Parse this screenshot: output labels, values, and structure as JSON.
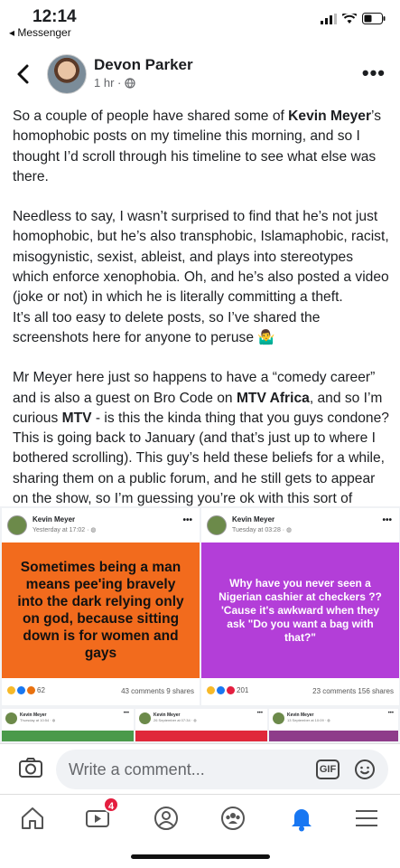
{
  "status_bar": {
    "time": "12:14",
    "back_app": "◂ Messenger"
  },
  "post": {
    "author": "Devon Parker",
    "timestamp": "1 hr ·",
    "paragraphs": [
      {
        "segments": [
          "So a couple of people have shared some of ",
          "Kevin Meyer",
          "’s homophobic posts on my timeline this morning, and so I thought I’d scroll through his timeline to see what else was there."
        ]
      },
      {
        "text": "Needless to say, I wasn’t surprised to find that he’s not just homophobic, but he’s also transphobic, Islamaphobic, racist, misogynistic, sexist, ableist, and plays into stereotypes which enforce xenophobia. Oh, and he’s also posted a video (joke or not) in which he is literally committing a theft."
      },
      {
        "text": "It’s all too easy to delete posts, so I’ve shared the screenshots here for anyone to peruse 🤷‍♂️"
      },
      {
        "segments": [
          "Mr Meyer here just so happens to have a “comedy career” and is also a guest on Bro Code on ",
          "MTV Africa",
          ", and so I’m curious ",
          "MTV",
          " - is this the kinda thing that you guys condone? This is going back to January (and that’s just up to where I bothered scrolling). This guy’s held these beliefs for a while, sharing them on a public forum, and he still gets to appear on the show, so I’m guessing you’re ok with this sort of thing?"
        ]
      }
    ]
  },
  "shared_posts": [
    {
      "name": "Kevin Meyer",
      "time": "Yesterday at 17:02 · ◍",
      "meme_text": "Sometimes being a man means pee'ing bravely into the dark relying only on god, because sitting down is for women and gays",
      "reaction_count": "62",
      "stats": "43 comments  9 shares",
      "bg_color": "#f26b1d"
    },
    {
      "name": "Kevin Meyer",
      "time": "Tuesday at 03:28 · ◍",
      "meme_text": "Why have you never seen a Nigerian cashier at checkers ?? 'Cause it's awkward when they ask \"Do you want a bag with that?\"",
      "reaction_count": "201",
      "stats": "23 comments  156 shares",
      "bg_color": "#b33ed8"
    }
  ],
  "mini_posts": [
    {
      "name": "Kevin Meyer",
      "time": "Thursday at 10:54 · ◍",
      "bar_color": "#4a9a4a"
    },
    {
      "name": "Kevin Meyer",
      "time": "26 September at 07:34 · ◍",
      "bar_color": "#e0283a"
    },
    {
      "name": "Kevin Meyer",
      "time": "13 September at 10:09 · ◍",
      "bar_color": "#8e3c8a"
    }
  ],
  "comment_bar": {
    "placeholder": "Write a comment...",
    "gif_label": "GIF"
  },
  "tab_bar": {
    "video_badge": "4"
  },
  "colors": {
    "accent": "#1877f2",
    "badge": "#e41e3f"
  }
}
